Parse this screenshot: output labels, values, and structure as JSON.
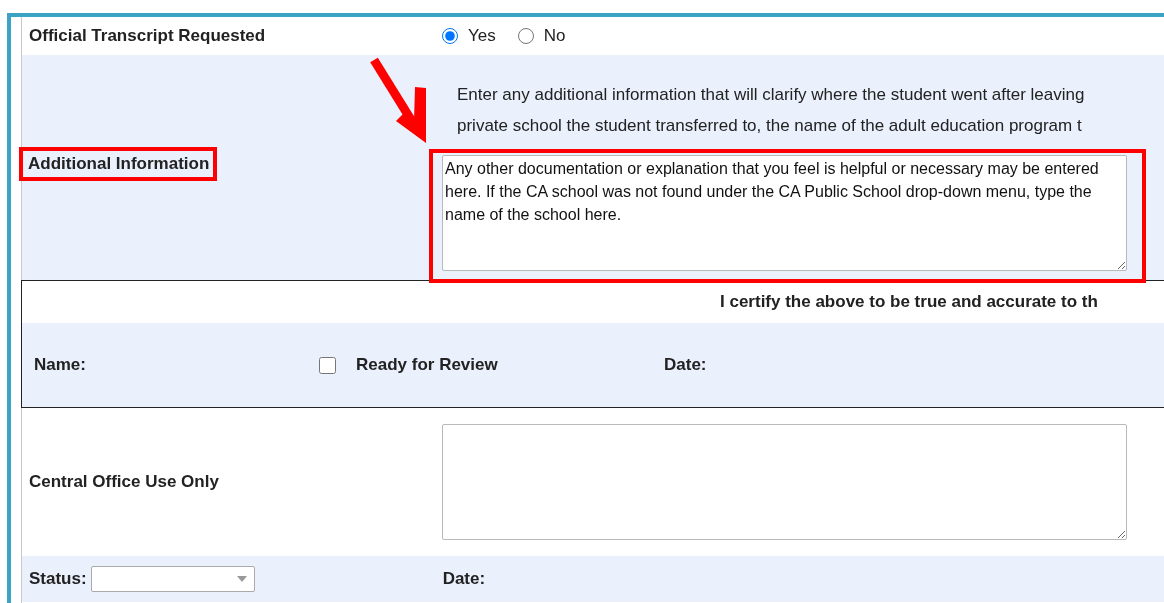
{
  "transcript": {
    "label": "Official Transcript Requested",
    "options": [
      {
        "label": "Yes",
        "selected": true
      },
      {
        "label": "No",
        "selected": false
      }
    ]
  },
  "additional": {
    "label": "Additional Information",
    "instructions": [
      "Enter any additional information that will clarify where the student went after leaving",
      "private school the student transferred to, the name of the adult education program t"
    ],
    "value": "Any other documentation or explanation that you feel is helpful or necessary may be entered here. If the CA school was not found under the CA Public School drop-down menu, type the name of the school here."
  },
  "certification": {
    "statement": "I certify the above to be true and accurate to th",
    "name_label": "Name:",
    "ready_for_review": {
      "label": "Ready for Review",
      "checked": false
    },
    "date_label": "Date:"
  },
  "central_office": {
    "label": "Central Office Use Only",
    "status_label": "Status:",
    "date_label": "Date:"
  }
}
